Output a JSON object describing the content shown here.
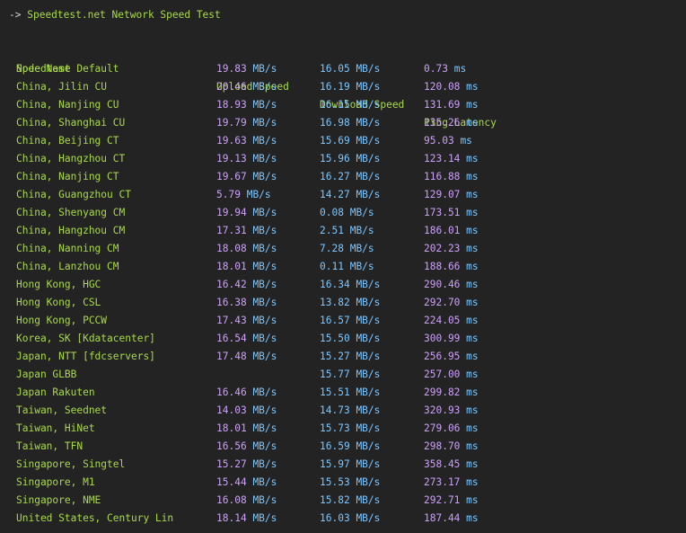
{
  "terminal": {
    "prompt": "->",
    "title": "Speedtest.net Network Speed Test",
    "headers": {
      "node": "Node Name",
      "upload": "Upload Speed",
      "download": "Download Speed",
      "ping": "Ping Latency"
    },
    "rows": [
      {
        "node": "Speedtest Default",
        "up": "19.83",
        "up_unit": "MB/s",
        "down": "16.05",
        "down_unit": "MB/s",
        "ping": "0.73",
        "ping_unit": "ms"
      },
      {
        "node": "China, Jilin CU",
        "up": "20.46",
        "up_unit": "MB/s",
        "down": "16.19",
        "down_unit": "MB/s",
        "ping": "120.08",
        "ping_unit": "ms"
      },
      {
        "node": "China, Nanjing CU",
        "up": "18.93",
        "up_unit": "MB/s",
        "down": "16.15",
        "down_unit": "MB/s",
        "ping": "131.69",
        "ping_unit": "ms"
      },
      {
        "node": "China, Shanghai CU",
        "up": "19.79",
        "up_unit": "MB/s",
        "down": "16.98",
        "down_unit": "MB/s",
        "ping": "135.26",
        "ping_unit": "ms"
      },
      {
        "node": "China, Beijing CT",
        "up": "19.63",
        "up_unit": "MB/s",
        "down": "15.69",
        "down_unit": "MB/s",
        "ping": "95.03",
        "ping_unit": "ms"
      },
      {
        "node": "China, Hangzhou CT",
        "up": "19.13",
        "up_unit": "MB/s",
        "down": "15.96",
        "down_unit": "MB/s",
        "ping": "123.14",
        "ping_unit": "ms"
      },
      {
        "node": "China, Nanjing CT",
        "up": "19.67",
        "up_unit": "MB/s",
        "down": "16.27",
        "down_unit": "MB/s",
        "ping": "116.88",
        "ping_unit": "ms"
      },
      {
        "node": "China, Guangzhou CT",
        "up": "5.79",
        "up_unit": "MB/s",
        "down": "14.27",
        "down_unit": "MB/s",
        "ping": "129.07",
        "ping_unit": "ms"
      },
      {
        "node": "China, Shenyang CM",
        "up": "19.94",
        "up_unit": "MB/s",
        "down": "0.08",
        "down_unit": "MB/s",
        "ping": "173.51",
        "ping_unit": "ms"
      },
      {
        "node": "China, Hangzhou CM",
        "up": "17.31",
        "up_unit": "MB/s",
        "down": "2.51",
        "down_unit": "MB/s",
        "ping": "186.01",
        "ping_unit": "ms"
      },
      {
        "node": "China, Nanning CM",
        "up": "18.08",
        "up_unit": "MB/s",
        "down": "7.28",
        "down_unit": "MB/s",
        "ping": "202.23",
        "ping_unit": "ms"
      },
      {
        "node": "China, Lanzhou CM",
        "up": "18.01",
        "up_unit": "MB/s",
        "down": "0.11",
        "down_unit": "MB/s",
        "ping": "188.66",
        "ping_unit": "ms"
      },
      {
        "node": "Hong Kong, HGC",
        "up": "16.42",
        "up_unit": "MB/s",
        "down": "16.34",
        "down_unit": "MB/s",
        "ping": "290.46",
        "ping_unit": "ms"
      },
      {
        "node": "Hong Kong, CSL",
        "up": "16.38",
        "up_unit": "MB/s",
        "down": "13.82",
        "down_unit": "MB/s",
        "ping": "292.70",
        "ping_unit": "ms"
      },
      {
        "node": "Hong Kong, PCCW",
        "up": "17.43",
        "up_unit": "MB/s",
        "down": "16.57",
        "down_unit": "MB/s",
        "ping": "224.05",
        "ping_unit": "ms"
      },
      {
        "node": "Korea, SK [Kdatacenter]",
        "up": "16.54",
        "up_unit": "MB/s",
        "down": "15.50",
        "down_unit": "MB/s",
        "ping": "300.99",
        "ping_unit": "ms"
      },
      {
        "node": "Japan, NTT [fdcservers]",
        "up": "17.48",
        "up_unit": "MB/s",
        "down": "15.27",
        "down_unit": "MB/s",
        "ping": "256.95",
        "ping_unit": "ms"
      },
      {
        "node": "Japan GLBB",
        "up": "",
        "up_unit": "",
        "down": "15.77",
        "down_unit": "MB/s",
        "ping": "257.00",
        "ping_unit": "ms"
      },
      {
        "node": "Japan Rakuten",
        "up": "16.46",
        "up_unit": "MB/s",
        "down": "15.51",
        "down_unit": "MB/s",
        "ping": "299.82",
        "ping_unit": "ms"
      },
      {
        "node": "Taiwan, Seednet",
        "up": "14.03",
        "up_unit": "MB/s",
        "down": "14.73",
        "down_unit": "MB/s",
        "ping": "320.93",
        "ping_unit": "ms"
      },
      {
        "node": "Taiwan, HiNet",
        "up": "18.01",
        "up_unit": "MB/s",
        "down": "15.73",
        "down_unit": "MB/s",
        "ping": "279.06",
        "ping_unit": "ms"
      },
      {
        "node": "Taiwan, TFN",
        "up": "16.56",
        "up_unit": "MB/s",
        "down": "16.59",
        "down_unit": "MB/s",
        "ping": "298.70",
        "ping_unit": "ms"
      },
      {
        "node": "Singapore, Singtel",
        "up": "15.27",
        "up_unit": "MB/s",
        "down": "15.97",
        "down_unit": "MB/s",
        "ping": "358.45",
        "ping_unit": "ms"
      },
      {
        "node": "Singapore, M1",
        "up": "15.44",
        "up_unit": "MB/s",
        "down": "15.53",
        "down_unit": "MB/s",
        "ping": "273.17",
        "ping_unit": "ms"
      },
      {
        "node": "Singapore, NME",
        "up": "16.08",
        "up_unit": "MB/s",
        "down": "15.82",
        "down_unit": "MB/s",
        "ping": "292.71",
        "ping_unit": "ms"
      },
      {
        "node": "United States, Century Lin",
        "up": "18.14",
        "up_unit": "MB/s",
        "down": "16.03",
        "down_unit": "MB/s",
        "ping": "187.44",
        "ping_unit": "ms"
      }
    ]
  },
  "colors": {
    "background": "#232323",
    "label_green": "#a9d94a",
    "value_purple": "#cba1f7",
    "unit_blue": "#7cc6ff"
  }
}
